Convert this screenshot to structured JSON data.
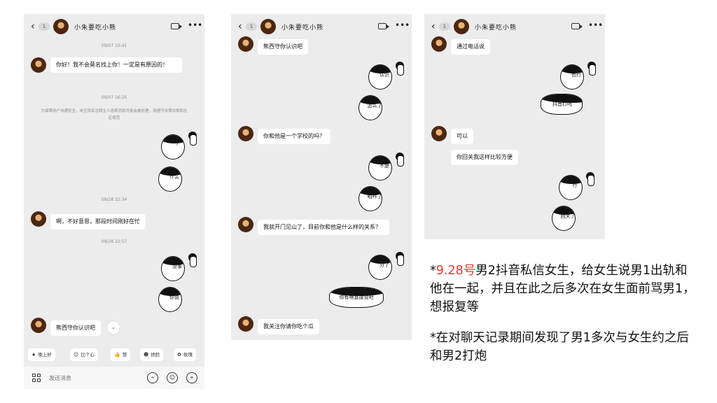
{
  "chat": {
    "contact_name": "小朱要吃小熊",
    "back_icon": "chevron-left-icon",
    "unread_badge": "1",
    "video_icon": "video-camera-icon",
    "more_icon": "more-dots-icon"
  },
  "screen1": {
    "ts1": "09/07 10:41",
    "msg1": "你好！我不会莫名找上你！一定是有原因的！",
    "ts2": "09/07 16:25",
    "notice": "为保障用户沟通安全，未互相关注陌生人连续消息可能会被处理，请遵守法律法规和社区规范",
    "sticker_q": "?",
    "sticker_what": "什么",
    "ts3": "09/28 22:34",
    "msg2": "啊，不好意思，那段时间刚好在忙",
    "ts4": "09/28 22:57",
    "sticker_ok": "没事",
    "sticker_say": "你说",
    "msg3": "熊西守你认识吧",
    "scroll_icon": "double-chevron-down-icon",
    "quick_replies": [
      {
        "icon": "★",
        "label": "晚上好"
      },
      {
        "icon": "☺",
        "label": "比个心"
      },
      {
        "icon": "👍",
        "label": "赞"
      },
      {
        "icon": "☻",
        "label": "捂脸"
      },
      {
        "icon": "✿",
        "label": "玫瑰"
      }
    ],
    "input_placeholder": "发送消息",
    "voice_icon": "voice-icon",
    "emoji_icon": "emoji-icon",
    "plus_icon": "plus-icon"
  },
  "screen2": {
    "msg1": "熊西守你认识吧",
    "sticker1": "认识",
    "sticker2": "怎么了",
    "msg2": "你和他是一个学校的吗？",
    "sticker3": "不是",
    "sticker4": "咱咋了",
    "msg3": "我就开门见山了，目前你和他是什么样的关系？",
    "sticker5": "分了",
    "sticker6": "你有啥直接说吧",
    "msg4": "我关注你请你吃个瓜"
  },
  "screen3": {
    "msg1": "通过电话说",
    "sticker1": "也行",
    "sticker2": "抖音打吗",
    "msg2": "可以",
    "msg3": "你回关我这样比较方便",
    "sticker3": "行",
    "sticker4": "回关了"
  },
  "caption1": {
    "date": "9.28号",
    "rest": "男2抖音私信女生，给女生说男1出轨和他在一起，并且在此之后多次在女生面前骂男1，想报复等",
    "prefix": "*"
  },
  "caption2": {
    "prefix": "*",
    "text": "在对聊天记录期间发现了男1多次与女生约之后和男2打炮"
  },
  "colors": {
    "highlight": "#e53935",
    "chat_bg": "#ececec"
  }
}
